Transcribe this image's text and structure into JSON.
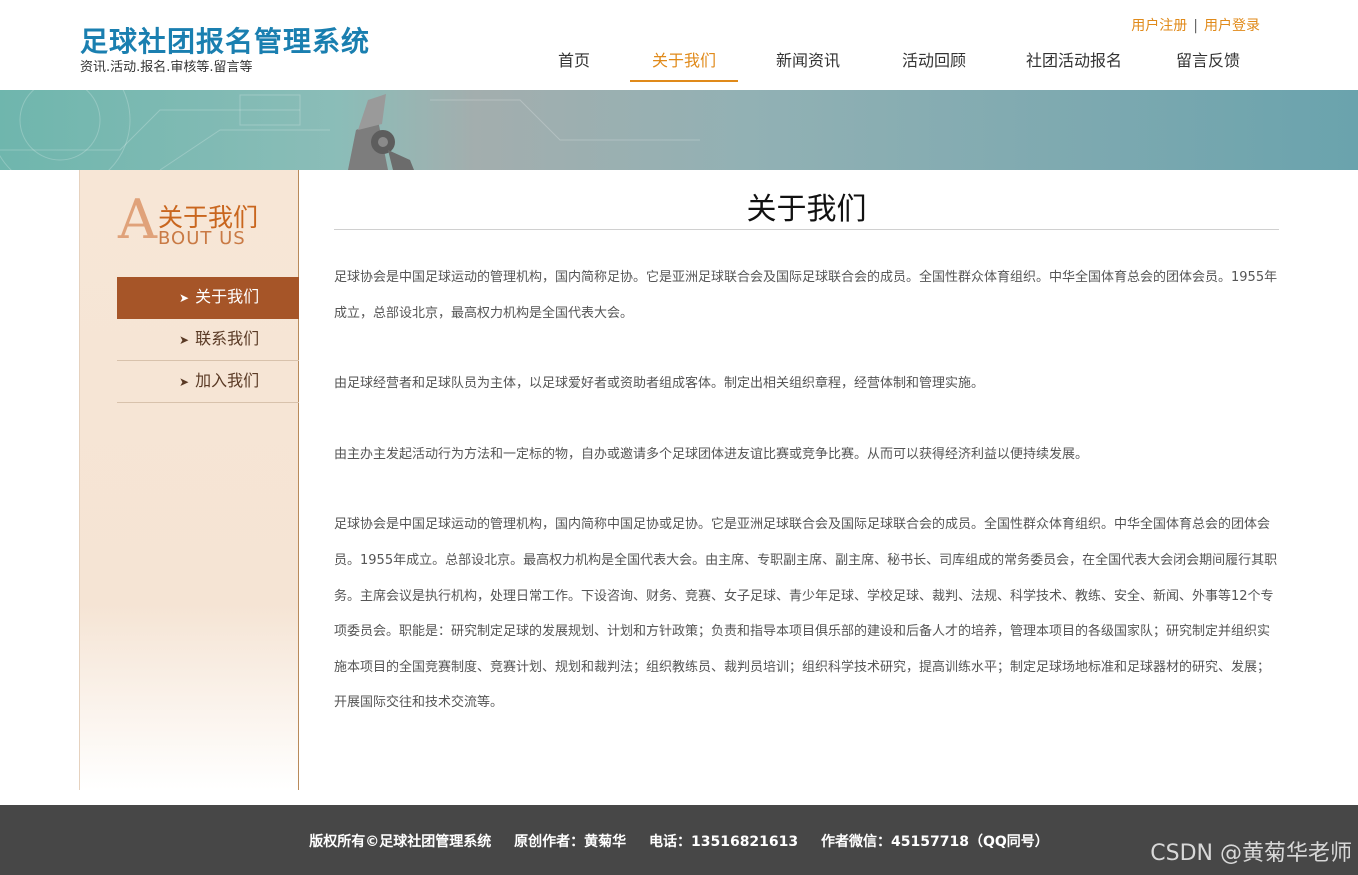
{
  "header": {
    "title": "足球社团报名管理系统",
    "subtitle": "资讯.活动.报名.审核等.留言等",
    "register": "用户注册",
    "separator": "|",
    "login": "用户登录"
  },
  "nav": [
    {
      "label": "首页",
      "active": false
    },
    {
      "label": "关于我们",
      "active": true
    },
    {
      "label": "新闻资讯",
      "active": false
    },
    {
      "label": "活动回顾",
      "active": false
    },
    {
      "label": "社团活动报名",
      "active": false
    },
    {
      "label": "留言反馈",
      "active": false
    }
  ],
  "sidebar": {
    "big_letter": "A",
    "title_cn": "关于我们",
    "title_en": "BOUT US",
    "items": [
      {
        "label": "关于我们",
        "active": true
      },
      {
        "label": "联系我们",
        "active": false
      },
      {
        "label": "加入我们",
        "active": false
      }
    ]
  },
  "main": {
    "title": "关于我们",
    "paragraphs": [
      "足球协会是中国足球运动的管理机构，国内简称足协。它是亚洲足球联合会及国际足球联合会的成员。全国性群众体育组织。中华全国体育总会的团体会员。1955年成立，总部设北京，最高权力机构是全国代表大会。",
      "由足球经营者和足球队员为主体，以足球爱好者或资助者组成客体。制定出相关组织章程，经营体制和管理实施。",
      "由主办主发起活动行为方法和一定标的物，自办或邀请多个足球团体进友谊比赛或竞争比赛。从而可以获得经济利益以便持续发展。",
      "足球协会是中国足球运动的管理机构，国内简称中国足协或足协。它是亚洲足球联合会及国际足球联合会的成员。全国性群众体育组织。中华全国体育总会的团体会员。1955年成立。总部设北京。最高权力机构是全国代表大会。由主席、专职副主席、副主席、秘书长、司库组成的常务委员会，在全国代表大会闭会期间履行其职务。主席会议是执行机构，处理日常工作。下设咨询、财务、竞赛、女子足球、青少年足球、学校足球、裁判、法规、科学技术、教练、安全、新闻、外事等12个专项委员会。职能是：研究制定足球的发展规划、计划和方针政策；负责和指导本项目俱乐部的建设和后备人才的培养，管理本项目的各级国家队；研究制定并组织实施本项目的全国竞赛制度、竞赛计划、规划和裁判法；组织教练员、裁判员培训；组织科学技术研究，提高训练水平；制定足球场地标准和足球器材的研究、发展；开展国际交往和技术交流等。"
    ]
  },
  "footer": {
    "copyright": "版权所有©足球社团管理系统",
    "author": "原创作者：黄菊华",
    "phone": "电话：13516821613",
    "wechat": "作者微信：45157718（QQ同号）"
  },
  "watermark": "CSDN @黄菊华老师",
  "colors": {
    "brand_blue": "#1a7fb0",
    "accent_orange": "#e08a1a",
    "sidebar_active": "#a65528",
    "footer_bg": "#474747"
  }
}
